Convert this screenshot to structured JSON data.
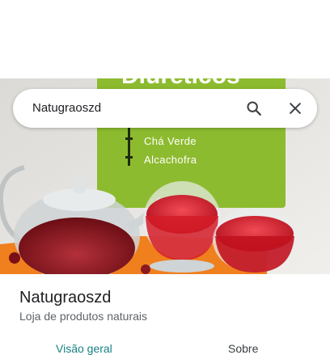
{
  "search": {
    "query": "Natugraoszd"
  },
  "hero_photo": {
    "poster_heading": "Diuréticos",
    "poster_items": [
      "Chá Verde",
      "Alcachofra"
    ]
  },
  "place": {
    "name": "Natugraoszd",
    "category": "Loja de produtos naturais"
  },
  "tabs": [
    {
      "label": "Visão geral",
      "selected": true
    },
    {
      "label": "Sobre",
      "selected": false
    }
  ],
  "colors": {
    "accent": "#188084",
    "poster_green": "#8dbb2f"
  }
}
